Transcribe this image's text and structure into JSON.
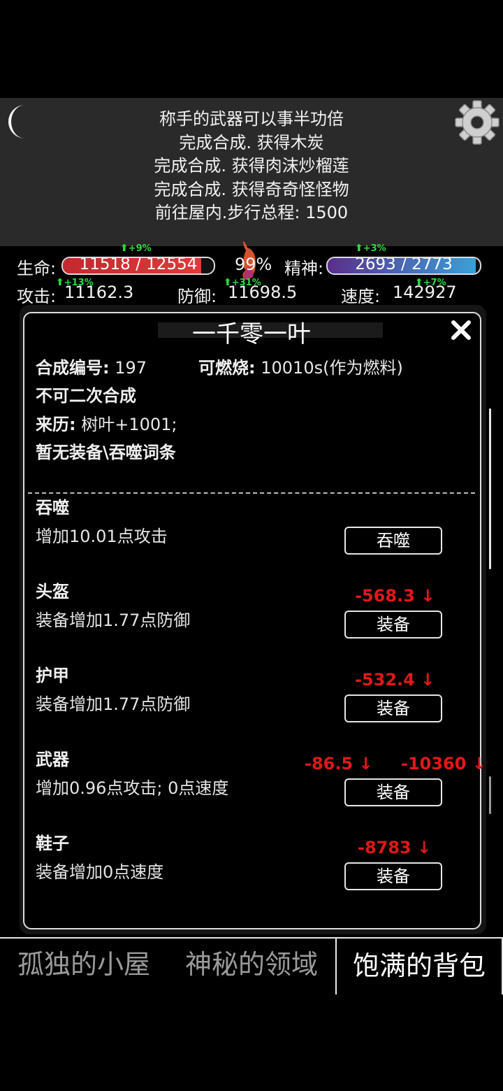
{
  "log": {
    "lines": [
      "称手的武器可以事半功倍",
      "完成合成. 获得木炭",
      "完成合成. 获得肉沫炒榴莲",
      "完成合成. 获得奇奇怪怪物",
      "前往屋内.步行总程: 1500"
    ]
  },
  "stats": {
    "hp": {
      "label": "生命:",
      "text": "11518 / 12554",
      "fraction": 0.917,
      "bonus": "+9%",
      "color": "#c22a2f"
    },
    "satiety": {
      "text": "99%",
      "color": "#d3542a"
    },
    "mp": {
      "label": "精神:",
      "text": "2693 / 2773",
      "fraction": 0.971,
      "bonus": "+3%",
      "color": "#5a2e8c"
    },
    "attack": {
      "label": "攻击:",
      "value": "11162.3",
      "bonus": "+13%"
    },
    "defense": {
      "label": "防御:",
      "value": "11698.5",
      "bonus": "+31%"
    },
    "speed": {
      "label": "速度:",
      "value": "142927",
      "bonus": "+7%"
    }
  },
  "panel": {
    "title": "一千零一叶",
    "id_label": "合成编号:",
    "id_value": "197",
    "burn_label": "可燃烧:",
    "burn_value": "10010s(作为燃料)",
    "no_resynth": "不可二次合成",
    "origin_label": "来历:",
    "origin_value": "树叶+1001;",
    "no_equip": "暂无装备\\吞噬词条",
    "sections": [
      {
        "title": "吞噬",
        "desc": "增加10.01点攻击",
        "button": "吞噬"
      },
      {
        "title": "头盔",
        "desc": "装备增加1.77点防御",
        "button": "装备",
        "delta": "-568.3 ↓"
      },
      {
        "title": "护甲",
        "desc": "装备增加1.77点防御",
        "button": "装备",
        "delta": "-532.4 ↓"
      },
      {
        "title": "武器",
        "desc": "增加0.96点攻击; 0点速度",
        "button": "装备",
        "delta": "-86.5 ↓",
        "delta2": "-10360 ↓"
      },
      {
        "title": "鞋子",
        "desc": "装备增加0点速度",
        "button": "装备",
        "delta": "-8783 ↓"
      }
    ]
  },
  "tabs": [
    "孤独的小屋",
    "神秘的领域",
    "饱满的背包"
  ],
  "icons": {
    "moon": "moon-icon",
    "gear": "gear-icon",
    "close": "close-icon",
    "stomach": "stomach-icon"
  }
}
